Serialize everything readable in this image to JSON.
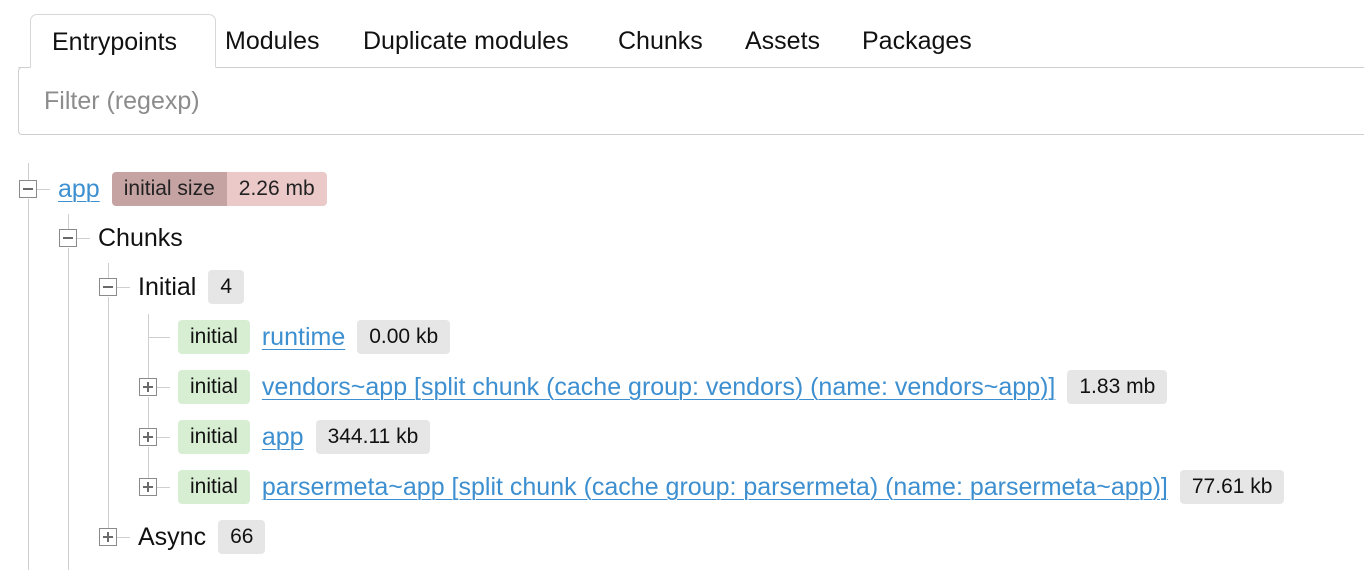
{
  "tabs": [
    {
      "label": "Entrypoints",
      "active": true
    },
    {
      "label": "Modules"
    },
    {
      "label": "Duplicate modules"
    },
    {
      "label": "Chunks"
    },
    {
      "label": "Assets"
    },
    {
      "label": "Packages"
    }
  ],
  "filter": {
    "placeholder": "Filter (regexp)",
    "value": ""
  },
  "entrypoint": {
    "name": "app",
    "size_label": "initial size",
    "size_value": "2.26 mb",
    "chunks_label": "Chunks",
    "initial": {
      "label": "Initial",
      "count": "4",
      "items": [
        {
          "tag": "initial",
          "name": "runtime",
          "size": "0.00 kb"
        },
        {
          "tag": "initial",
          "name": "vendors~app [split chunk (cache group: vendors) (name: vendors~app)]",
          "size": "1.83 mb"
        },
        {
          "tag": "initial",
          "name": "app",
          "size": "344.11 kb"
        },
        {
          "tag": "initial",
          "name": "parsermeta~app [split chunk (cache group: parsermeta) (name: parsermeta~app)]",
          "size": "77.61 kb"
        }
      ]
    },
    "async": {
      "label": "Async",
      "count": "66"
    }
  },
  "colors": {
    "link": "#3d8fd0",
    "initial_tag_bg": "#d8eed3",
    "badge_bg": "#e6e6e6",
    "size_label_bg": "#c6a3a3",
    "size_value_bg": "#ebc9c9"
  },
  "icons": {
    "expanded": "minus-square-icon",
    "collapsed": "plus-square-icon"
  }
}
